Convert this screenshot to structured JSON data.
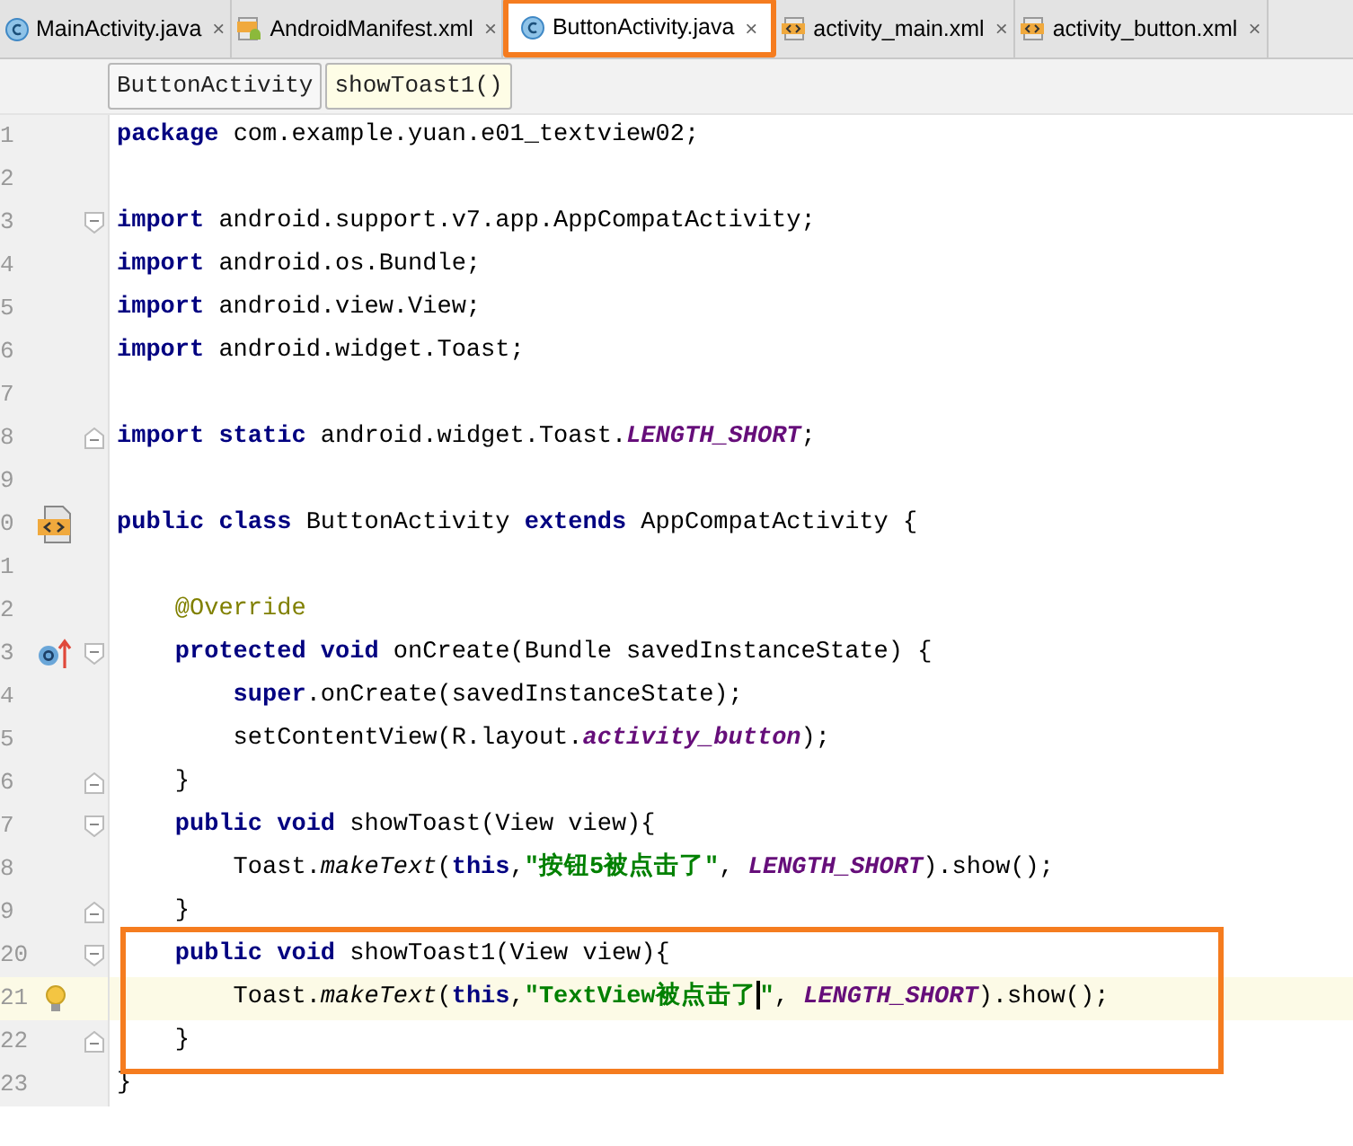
{
  "tabs": [
    {
      "label": "MainActivity.java",
      "kind": "class",
      "selected": false,
      "close": "×"
    },
    {
      "label": "AndroidManifest.xml",
      "kind": "manifest",
      "selected": false,
      "close": "×"
    },
    {
      "label": "ButtonActivity.java",
      "kind": "class",
      "selected": true,
      "close": "×"
    },
    {
      "label": "activity_main.xml",
      "kind": "layout",
      "selected": false,
      "close": "×"
    },
    {
      "label": "activity_button.xml",
      "kind": "layout",
      "selected": false,
      "close": "×"
    }
  ],
  "breadcrumbs": [
    {
      "label": "ButtonActivity",
      "selected": false
    },
    {
      "label": "showToast1()",
      "selected": true
    }
  ],
  "lines": [
    {
      "kind": "line",
      "number": "1",
      "fold_open": false,
      "fold_close": false,
      "current": false,
      "segments": [
        {
          "kind": "kw",
          "text": "package"
        },
        {
          "kind": "plain",
          "text": " com.example.yuan.e01_textview02;"
        }
      ]
    },
    {
      "kind": "line",
      "number": "2",
      "fold_open": false,
      "fold_close": false,
      "current": false
    },
    {
      "kind": "line",
      "number": "3",
      "fold_open": true,
      "fold_close": false,
      "current": false,
      "segments": [
        {
          "kind": "kw",
          "text": "import"
        },
        {
          "kind": "plain",
          "text": " android.support.v7.app.AppCompatActivity;"
        }
      ]
    },
    {
      "kind": "line",
      "number": "4",
      "fold_open": false,
      "fold_close": false,
      "current": false,
      "segments": [
        {
          "kind": "kw",
          "text": "import"
        },
        {
          "kind": "plain",
          "text": " android.os.Bundle;"
        }
      ]
    },
    {
      "kind": "line",
      "number": "5",
      "fold_open": false,
      "fold_close": false,
      "current": false,
      "segments": [
        {
          "kind": "kw",
          "text": "import"
        },
        {
          "kind": "plain",
          "text": " android.view.View;"
        }
      ]
    },
    {
      "kind": "line",
      "number": "6",
      "fold_open": false,
      "fold_close": false,
      "current": false,
      "segments": [
        {
          "kind": "kw",
          "text": "import"
        },
        {
          "kind": "plain",
          "text": " android.widget.Toast;"
        }
      ]
    },
    {
      "kind": "line",
      "number": "7",
      "fold_open": false,
      "fold_close": false,
      "current": false
    },
    {
      "kind": "line",
      "number": "8",
      "fold_open": false,
      "fold_close": true,
      "current": false,
      "segments": [
        {
          "kind": "kw",
          "text": "import static"
        },
        {
          "kind": "plain",
          "text": " android.widget.Toast."
        },
        {
          "kind": "field",
          "text": "LENGTH_SHORT"
        },
        {
          "kind": "plain",
          "text": ";"
        }
      ]
    },
    {
      "kind": "line",
      "number": "9",
      "fold_open": false,
      "fold_close": false,
      "current": false
    },
    {
      "kind": "line",
      "number": "0",
      "fold_open": false,
      "fold_close": false,
      "current": false,
      "gutter": {
        "kind": "xml"
      },
      "segments": [
        {
          "kind": "kw",
          "text": "public class"
        },
        {
          "kind": "plain",
          "text": " ButtonActivity "
        },
        {
          "kind": "kw",
          "text": "extends"
        },
        {
          "kind": "plain",
          "text": " AppCompatActivity {"
        }
      ]
    },
    {
      "kind": "line",
      "number": "1",
      "fold_open": false,
      "fold_close": false,
      "current": false
    },
    {
      "kind": "line",
      "number": "2",
      "fold_open": false,
      "fold_close": false,
      "current": false,
      "segments": [
        {
          "kind": "annotation",
          "text": "    @Override"
        }
      ]
    },
    {
      "kind": "line",
      "number": "3",
      "fold_open": true,
      "fold_close": false,
      "current": false,
      "gutter": {
        "kind": "override"
      },
      "segments": [
        {
          "kind": "kw",
          "text": "    protected void"
        },
        {
          "kind": "plain",
          "text": " onCreate(Bundle savedInstanceState) {"
        }
      ]
    },
    {
      "kind": "line",
      "number": "4",
      "fold_open": false,
      "fold_close": false,
      "current": false,
      "segments": [
        {
          "kind": "kw",
          "text": "        super"
        },
        {
          "kind": "plain",
          "text": ".onCreate(savedInstanceState);"
        }
      ]
    },
    {
      "kind": "line",
      "number": "5",
      "fold_open": false,
      "fold_close": false,
      "current": false,
      "segments": [
        {
          "kind": "plain",
          "text": "        setContentView(R.layout."
        },
        {
          "kind": "field",
          "text": "activity_button"
        },
        {
          "kind": "plain",
          "text": ");"
        }
      ]
    },
    {
      "kind": "line",
      "number": "6",
      "fold_open": false,
      "fold_close": true,
      "current": false,
      "segments": [
        {
          "kind": "plain",
          "text": "    }"
        }
      ]
    },
    {
      "kind": "line",
      "number": "7",
      "fold_open": true,
      "fold_close": false,
      "current": false,
      "segments": [
        {
          "kind": "kw",
          "text": "    public void"
        },
        {
          "kind": "plain",
          "text": " showToast(View view){"
        }
      ]
    },
    {
      "kind": "line",
      "number": "8",
      "fold_open": false,
      "fold_close": false,
      "current": false,
      "segments": [
        {
          "kind": "plain",
          "text": "        Toast."
        },
        {
          "kind": "method",
          "text": "makeText"
        },
        {
          "kind": "plain",
          "text": "("
        },
        {
          "kind": "kw",
          "text": "this"
        },
        {
          "kind": "plain",
          "text": ","
        },
        {
          "kind": "str",
          "text": "\"按钮5被点击了\""
        },
        {
          "kind": "plain",
          "text": ", "
        },
        {
          "kind": "field",
          "text": "LENGTH_SHORT"
        },
        {
          "kind": "plain",
          "text": ").show();"
        }
      ]
    },
    {
      "kind": "line",
      "number": "9",
      "fold_open": false,
      "fold_close": true,
      "current": false,
      "segments": [
        {
          "kind": "plain",
          "text": "    }"
        }
      ]
    },
    {
      "kind": "frame",
      "lines": [
        {
          "number": "20",
          "fold_open": true,
          "fold_close": false,
          "current": false,
          "segments": [
            {
              "kind": "kw",
              "text": "    public void"
            },
            {
              "kind": "plain",
              "text": " showToast1(View view){"
            }
          ]
        },
        {
          "number": "21",
          "fold_open": false,
          "fold_close": false,
          "current": true,
          "gutter": {
            "kind": "bulb"
          },
          "segments": [
            {
              "kind": "plain",
              "text": "        Toast."
            },
            {
              "kind": "method",
              "text": "makeText"
            },
            {
              "kind": "plain",
              "text": "("
            },
            {
              "kind": "kw",
              "text": "this"
            },
            {
              "kind": "plain",
              "text": ","
            },
            {
              "kind": "str",
              "text": "\"TextView被点击了"
            },
            {
              "kind": "caret"
            },
            {
              "kind": "str",
              "text": "\""
            },
            {
              "kind": "plain",
              "text": ", "
            },
            {
              "kind": "field",
              "text": "LENGTH_SHORT"
            },
            {
              "kind": "plain",
              "text": ").show();"
            }
          ]
        },
        {
          "number": "22",
          "fold_open": false,
          "fold_close": true,
          "current": false,
          "segments": [
            {
              "kind": "plain",
              "text": "    }"
            }
          ]
        }
      ]
    },
    {
      "kind": "line",
      "number": "23",
      "fold_open": false,
      "fold_close": false,
      "current": false,
      "segments": [
        {
          "kind": "plain",
          "text": "}"
        }
      ]
    }
  ]
}
